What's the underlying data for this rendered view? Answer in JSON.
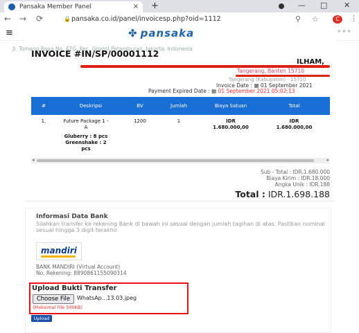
{
  "browser": {
    "tab_title": "Pansaka Member Panel",
    "tab_close": "×",
    "new_tab": "+",
    "url": "pansaka.co.id/panel/invoicesp.php?oid=1112",
    "min": "—",
    "max": "□",
    "close": "✕",
    "profile_initial": "C"
  },
  "site": {
    "logo": "pansaka",
    "menu_icon": "≡",
    "more": "∘∘∘"
  },
  "invoice": {
    "address": "Jl. Tomang Raya No. 47G, Kec. Grogol Petamburan, Jakarta, Indonesia",
    "title": "INVOICE #IN/SP/00001112",
    "buyer": "ILHAM,",
    "city": "Tangerang, Banten 15710",
    "district": "Tangerang (Kabupaten) - 15710",
    "invoice_date_label": "Invoice Date :",
    "invoice_date": "01 September 2021",
    "payment_expired_label": "Payment Expired Date :",
    "payment_expired": "01 September 2021 05:02:13"
  },
  "table": {
    "headers": [
      "#",
      "Deskripsi",
      "BV",
      "Jumlah",
      "Biaya Satuan",
      "Total"
    ],
    "row": {
      "no": "1.",
      "desc": "Future Package 1 - A",
      "items": "Gluberry : 8 pcs Greenshake : 2 pcs",
      "bv": "1200",
      "qty": "1",
      "unit_cur": "IDR",
      "unit": "1.680.000,00",
      "total_cur": "IDR",
      "total": "1.680.000,00"
    }
  },
  "totals": {
    "subtotal": "Sub - Total : IDR.1.680.000",
    "shipping": "Biaya Kirim : IDR.18.000",
    "unique": "Angka Unik : IDR.188",
    "grand_label": "Total :",
    "grand_value": "IDR.1.698.188"
  },
  "bank": {
    "heading": "Informasi Data Bank",
    "desc": "Silahkan transfer ke rekening Bank di bawah ini sesuai dengan jumlah tagihan di atas. Pastikan nominal sesuai hingga 3 digit terakhir.",
    "logo_text": "mandiri",
    "name": "BANK MANDIRI (Virtual Account)",
    "account": "No. Rekening: 8890861155090314"
  },
  "upload": {
    "heading": "Upload Bukti Transfer",
    "choose_label": "Choose File",
    "file_name": "WhatsAp...13.03.jpeg",
    "max_file": "(Maksimal File 500KB)",
    "button": "Upload"
  }
}
